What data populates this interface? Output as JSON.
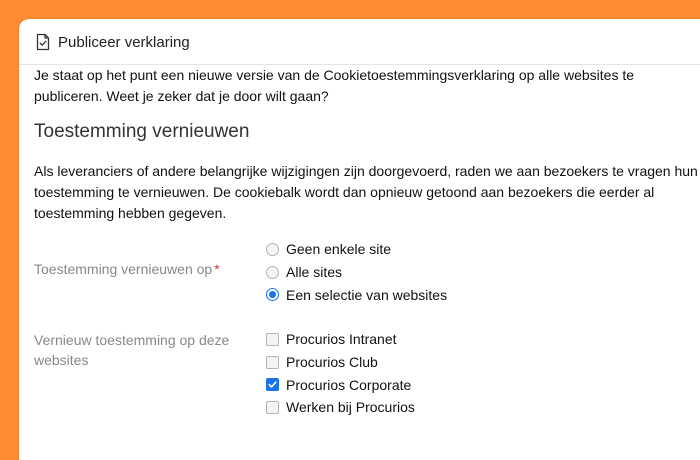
{
  "dialog": {
    "title": "Publiceer verklaring",
    "title_icon": "document-check-icon",
    "intro": "Je staat op het punt een nieuwe versie van de Cookietoestemmingsverklaring op alle websites te publiceren. Weet je zeker dat je door wilt gaan?"
  },
  "section": {
    "title": "Toestemming vernieuwen",
    "text": "Als leveranciers of andere belangrijke wijzigingen zijn doorgevoerd, raden we aan bezoekers te vragen hun toestemming te vernieuwen. De cookiebalk wordt dan opnieuw getoond aan bezoekers die eerder al toestemming hebben gegeven."
  },
  "renew_field": {
    "label": "Toestemming vernieuwen op",
    "required_mark": "*",
    "options": [
      {
        "label": "Geen enkele site",
        "checked": false
      },
      {
        "label": "Alle sites",
        "checked": false
      },
      {
        "label": "Een selectie van websites",
        "checked": true
      }
    ]
  },
  "sites_field": {
    "label": "Vernieuw toestemming op deze websites",
    "options": [
      {
        "label": "Procurios Intranet",
        "checked": false
      },
      {
        "label": "Procurios Club",
        "checked": false
      },
      {
        "label": "Procurios Corporate",
        "checked": true
      },
      {
        "label": "Werken bij Procurios",
        "checked": false
      }
    ]
  },
  "colors": {
    "background": "#FF8A33",
    "accent": "#1a73e8",
    "required": "#e03030"
  }
}
